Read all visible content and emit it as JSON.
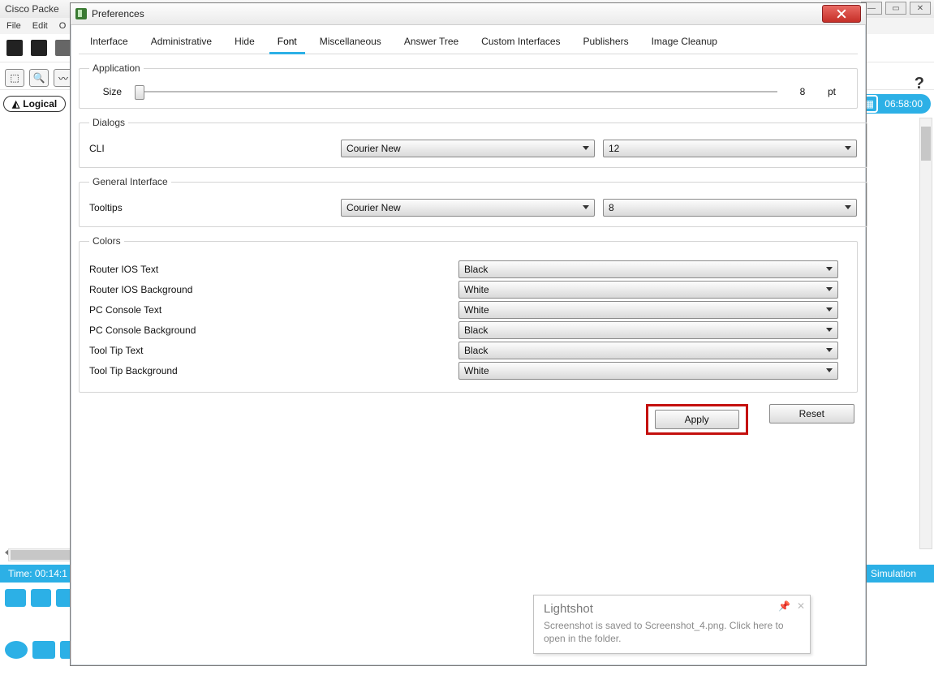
{
  "bg": {
    "app_title": "Cisco Packe",
    "menus": [
      "File",
      "Edit",
      "O"
    ],
    "help_glyph": "?",
    "logical_label": "Logical",
    "clock_time": "06:58:00",
    "time_bar": "Time: 00:14:1",
    "simulation_label": "Simulation"
  },
  "dialog": {
    "title": "Preferences",
    "tabs": [
      "Interface",
      "Administrative",
      "Hide",
      "Font",
      "Miscellaneous",
      "Answer Tree",
      "Custom Interfaces",
      "Publishers",
      "Image Cleanup"
    ],
    "active_tab_index": 3,
    "application": {
      "legend": "Application",
      "size_label": "Size",
      "size_value": "8",
      "size_unit": "pt"
    },
    "dialogs": {
      "legend": "Dialogs",
      "cli_label": "CLI",
      "cli_font": "Courier New",
      "cli_size": "12"
    },
    "general_interface": {
      "legend": "General Interface",
      "tooltips_label": "Tooltips",
      "tooltips_font": "Courier New",
      "tooltips_size": "8"
    },
    "colors": {
      "legend": "Colors",
      "rows": [
        {
          "label": "Router IOS Text",
          "value": "Black"
        },
        {
          "label": "Router IOS Background",
          "value": "White"
        },
        {
          "label": "PC Console Text",
          "value": "White"
        },
        {
          "label": "PC Console Background",
          "value": "Black"
        },
        {
          "label": "Tool Tip Text",
          "value": "Black"
        },
        {
          "label": "Tool Tip Background",
          "value": "White"
        }
      ]
    },
    "buttons": {
      "apply": "Apply",
      "reset": "Reset"
    }
  },
  "toast": {
    "title": "Lightshot",
    "message": "Screenshot is saved to Screenshot_4.png. Click here to open in the folder."
  }
}
